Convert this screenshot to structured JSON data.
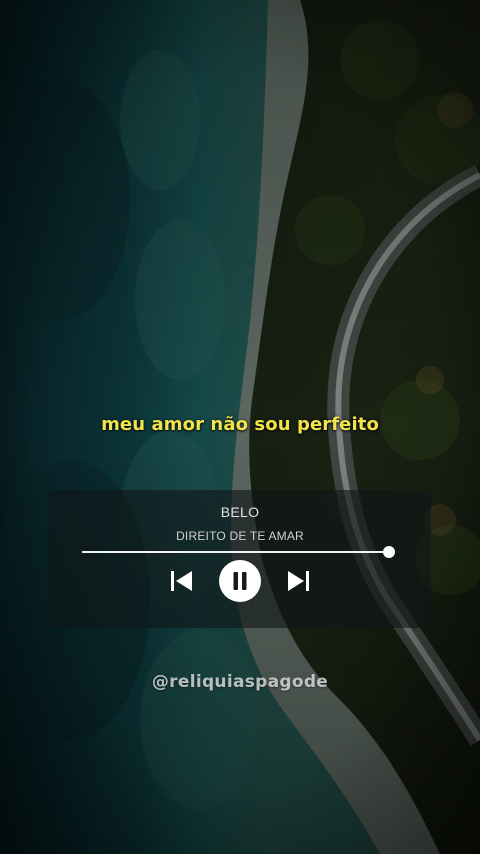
{
  "lyric": {
    "line": "meu amor não sou perfeito",
    "color": "#f2e34a"
  },
  "player": {
    "artist": "BELO",
    "song_title": "DIREITO DE TE AMAR",
    "progress_fraction": 0.99,
    "controls": {
      "previous": "skip-previous-icon",
      "play_pause": "pause-icon",
      "next": "skip-next-icon"
    }
  },
  "watermark": {
    "handle": "@reliquiaspagode"
  }
}
